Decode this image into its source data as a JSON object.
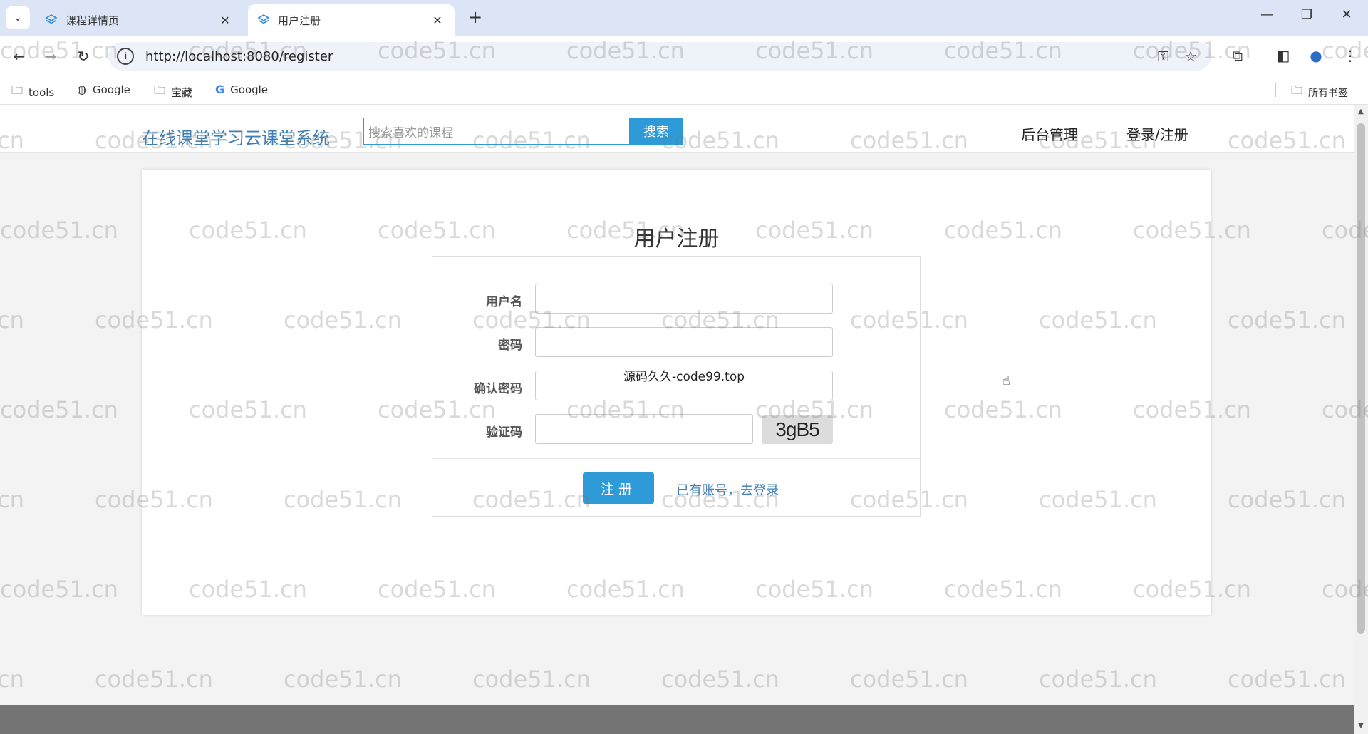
{
  "browser": {
    "tabs": [
      {
        "title": "课程详情页",
        "active": false
      },
      {
        "title": "用户注册",
        "active": true
      }
    ],
    "url": "http://localhost:8080/register",
    "bookmarks": [
      "tools",
      "Google",
      "宝藏",
      "Google"
    ],
    "all_bookmarks": "所有书签"
  },
  "header": {
    "site_title": "在线课堂学习云课堂系统",
    "search_placeholder": "搜索喜欢的课程",
    "search_button": "搜索",
    "nav": [
      "后台管理",
      "登录/注册"
    ]
  },
  "register": {
    "title": "用户注册",
    "fields": [
      {
        "label": "用户名",
        "value": ""
      },
      {
        "label": "密码",
        "value": ""
      },
      {
        "label": "确认密码",
        "value": ""
      },
      {
        "label": "验证码",
        "value": ""
      }
    ],
    "captcha": "3gB5",
    "submit": "注册",
    "login_link": "已有账号，去登录"
  },
  "overlay_text": "源码久久-code99.top",
  "watermark": "code51.cn",
  "colors": {
    "accent": "#2e9bd8",
    "link": "#3f7fb5"
  }
}
